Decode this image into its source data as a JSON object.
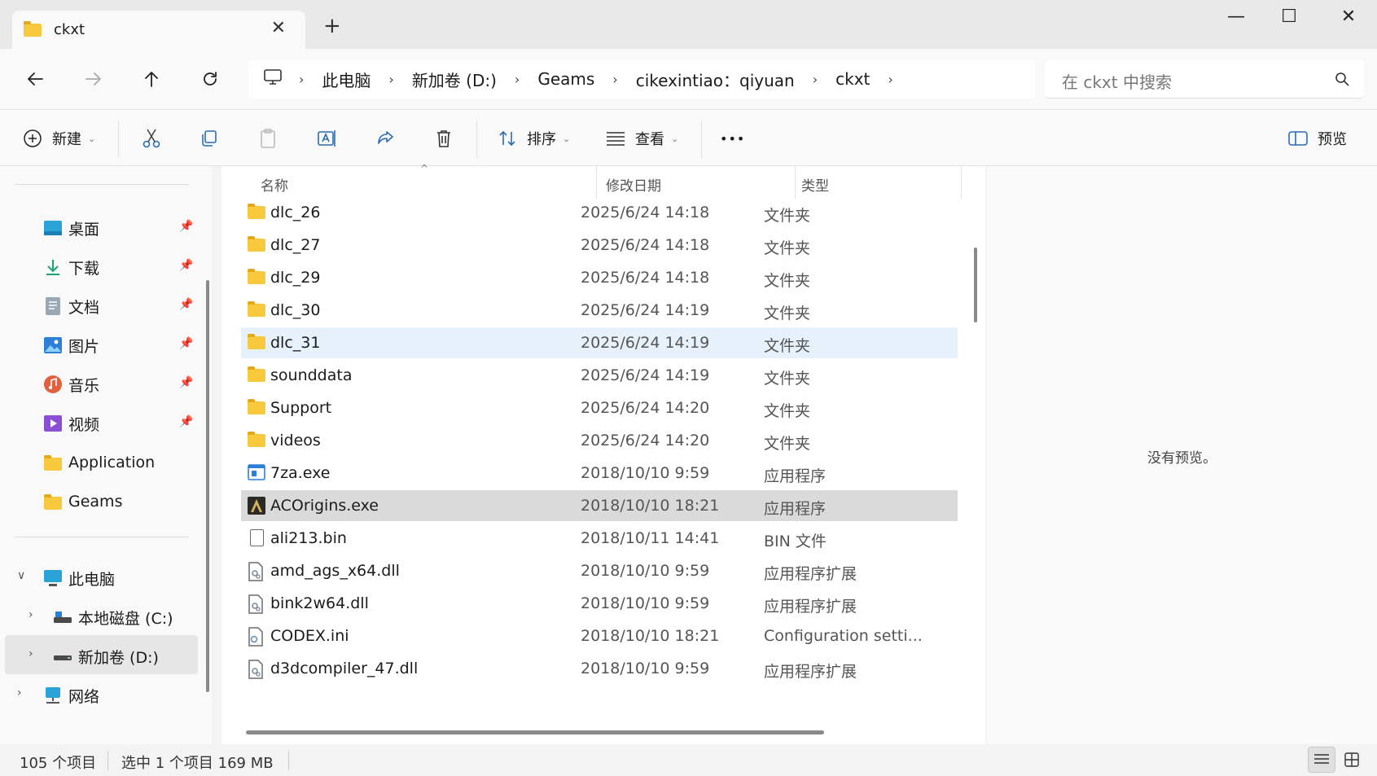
{
  "window": {
    "tab_title": "ckxt",
    "new_tab": "+",
    "minimize": "—",
    "maximize": "☐",
    "close": "✕"
  },
  "address": {
    "breadcrumb": [
      "此电脑",
      "新加卷 (D:)",
      "Geams",
      "cikexintiao：qiyuan",
      "ckxt"
    ],
    "search_placeholder": "在 ckxt 中搜索"
  },
  "toolbar": {
    "new_label": "新建",
    "sort_label": "排序",
    "view_label": "查看",
    "more_label": "•••",
    "preview_label": "预览"
  },
  "nav": {
    "quick_access": [
      {
        "label": "桌面",
        "icon": "desktop-icon"
      },
      {
        "label": "下载",
        "icon": "download-icon"
      },
      {
        "label": "文档",
        "icon": "documents-icon"
      },
      {
        "label": "图片",
        "icon": "pictures-icon"
      },
      {
        "label": "音乐",
        "icon": "music-icon"
      },
      {
        "label": "视频",
        "icon": "videos-icon"
      },
      {
        "label": "Application",
        "icon": "folder-icon"
      },
      {
        "label": "Geams",
        "icon": "folder-icon"
      }
    ],
    "this_pc": "此电脑",
    "drive_c": "本地磁盘 (C:)",
    "drive_d": "新加卷 (D:)",
    "network": "网络"
  },
  "columns": {
    "name": "名称",
    "date": "修改日期",
    "type": "类型"
  },
  "files": [
    {
      "name": "dlc_26",
      "date": "2025/6/24 14:18",
      "type": "文件夹",
      "icon": "folder"
    },
    {
      "name": "dlc_27",
      "date": "2025/6/24 14:18",
      "type": "文件夹",
      "icon": "folder"
    },
    {
      "name": "dlc_29",
      "date": "2025/6/24 14:18",
      "type": "文件夹",
      "icon": "folder"
    },
    {
      "name": "dlc_30",
      "date": "2025/6/24 14:19",
      "type": "文件夹",
      "icon": "folder"
    },
    {
      "name": "dlc_31",
      "date": "2025/6/24 14:19",
      "type": "文件夹",
      "icon": "folder"
    },
    {
      "name": "sounddata",
      "date": "2025/6/24 14:19",
      "type": "文件夹",
      "icon": "folder"
    },
    {
      "name": "Support",
      "date": "2025/6/24 14:20",
      "type": "文件夹",
      "icon": "folder"
    },
    {
      "name": "videos",
      "date": "2025/6/24 14:20",
      "type": "文件夹",
      "icon": "folder"
    },
    {
      "name": "7za.exe",
      "date": "2018/10/10 9:59",
      "type": "应用程序",
      "icon": "exe"
    },
    {
      "name": "ACOrigins.exe",
      "date": "2018/10/10 18:21",
      "type": "应用程序",
      "icon": "game-exe"
    },
    {
      "name": "ali213.bin",
      "date": "2018/10/11 14:41",
      "type": "BIN 文件",
      "icon": "file"
    },
    {
      "name": "amd_ags_x64.dll",
      "date": "2018/10/10 9:59",
      "type": "应用程序扩展",
      "icon": "dll"
    },
    {
      "name": "bink2w64.dll",
      "date": "2018/10/10 9:59",
      "type": "应用程序扩展",
      "icon": "dll"
    },
    {
      "name": "CODEX.ini",
      "date": "2018/10/10 18:21",
      "type": "Configuration setti...",
      "icon": "ini"
    },
    {
      "name": "d3dcompiler_47.dll",
      "date": "2018/10/10 9:59",
      "type": "应用程序扩展",
      "icon": "dll"
    }
  ],
  "preview": {
    "message": "没有预览。"
  },
  "status": {
    "item_count": "105 个项目",
    "selection": "选中 1 个项目  169 MB"
  },
  "colors": {
    "folder": "#f8c93d",
    "selected_row": "#dadada",
    "hover_row": "#e6f1fb",
    "accent": "#0067c0"
  }
}
